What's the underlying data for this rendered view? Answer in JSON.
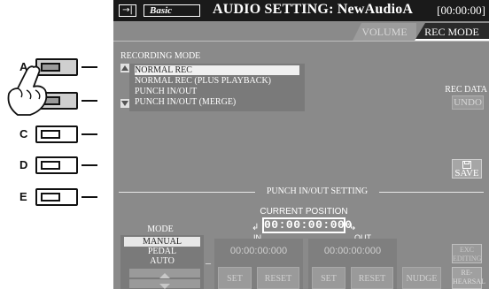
{
  "hardware": {
    "buttons": [
      {
        "letter": "A",
        "pressed": true
      },
      {
        "letter": "",
        "pressed": true
      },
      {
        "letter": "C",
        "pressed": false
      },
      {
        "letter": "D",
        "pressed": false
      },
      {
        "letter": "E",
        "pressed": false
      }
    ]
  },
  "titlebar": {
    "icon": "→|",
    "mode": "Basic",
    "title": "AUDIO SETTING: NewAudioA",
    "time": "[00:00:00]"
  },
  "tabs": {
    "volume": "VOLUME",
    "rec_mode": "REC MODE"
  },
  "recording_mode": {
    "label": "RECORDING MODE",
    "items": [
      "NORMAL REC",
      "NORMAL REC (PLUS PLAYBACK)",
      "PUNCH IN/OUT",
      "PUNCH IN/OUT (MERGE)"
    ],
    "selected_index": 0
  },
  "rec_data": {
    "label": "REC DATA",
    "undo": "UNDO"
  },
  "save": {
    "label": "SAVE"
  },
  "punch": {
    "section_label": "PUNCH IN/OUT SETTING",
    "current_position_label": "CURRENT POSITION",
    "current_position": "00:00:00:000",
    "in_label": "IN",
    "out_label": "OUT",
    "in_time": "00:00:00:000",
    "out_time": "00:00:00:000",
    "set": "SET",
    "reset": "RESET",
    "nudge": "NUDGE",
    "dash": "–"
  },
  "mode": {
    "label": "MODE",
    "items": [
      "MANUAL",
      "PEDAL",
      "AUTO"
    ],
    "selected_index": 0
  },
  "side_buttons": {
    "exc_line1": "EXC",
    "exc_line2": "EDITING",
    "rehearsal_line1": "RE-",
    "rehearsal_line2": "HEARSAL"
  }
}
